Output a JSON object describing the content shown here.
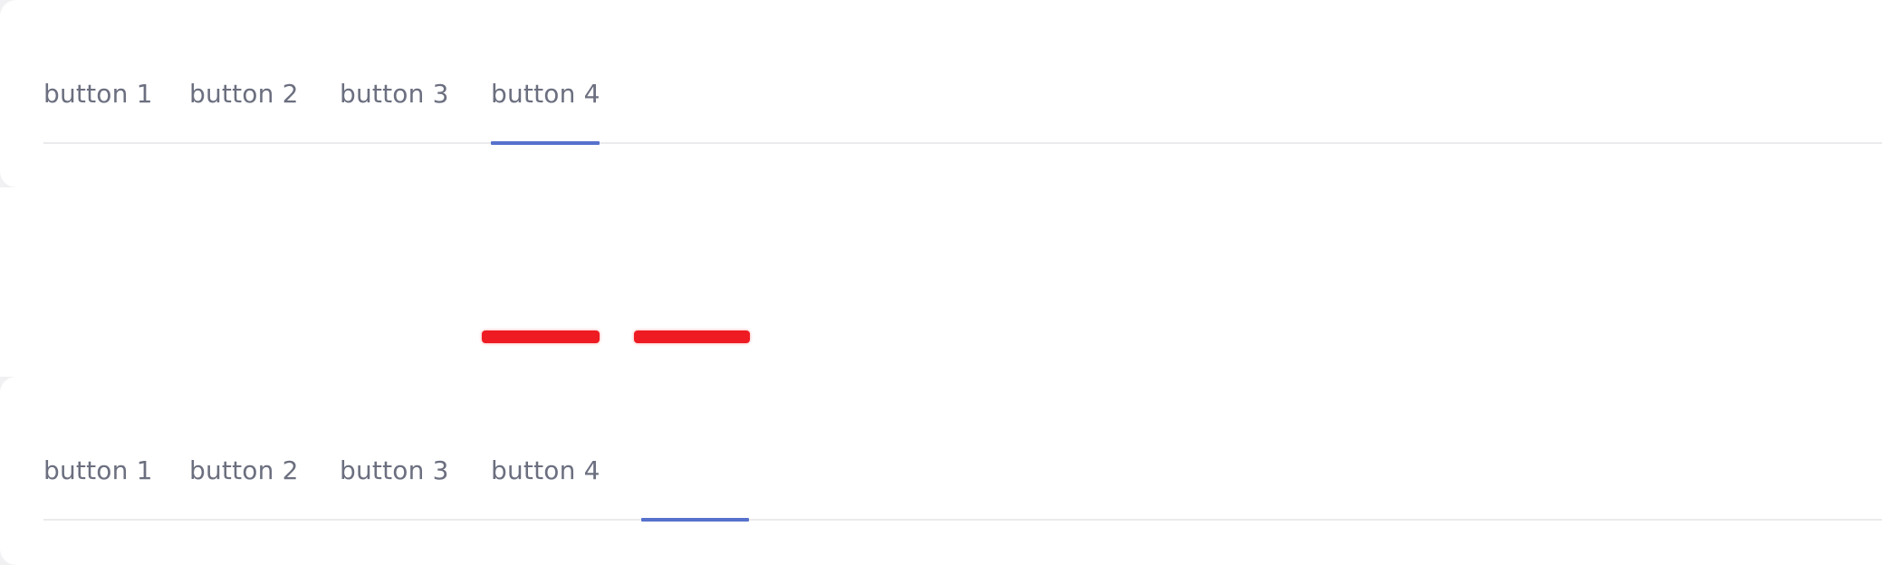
{
  "colors": {
    "page_background": "#ffffff",
    "tab_text": "#6b6f7f",
    "active_indicator": "#5771cc",
    "divider": "#ebebee",
    "red_mark": "#ee1b22"
  },
  "top_tabs": {
    "items": [
      {
        "label": "button 1"
      },
      {
        "label": "button 2"
      },
      {
        "label": "button 3"
      },
      {
        "label": "button 4"
      }
    ],
    "active_index": 3
  },
  "bottom_tabs": {
    "items": [
      {
        "label": "button 1"
      },
      {
        "label": "button 2"
      },
      {
        "label": "button 3"
      },
      {
        "label": "button 4"
      }
    ]
  }
}
